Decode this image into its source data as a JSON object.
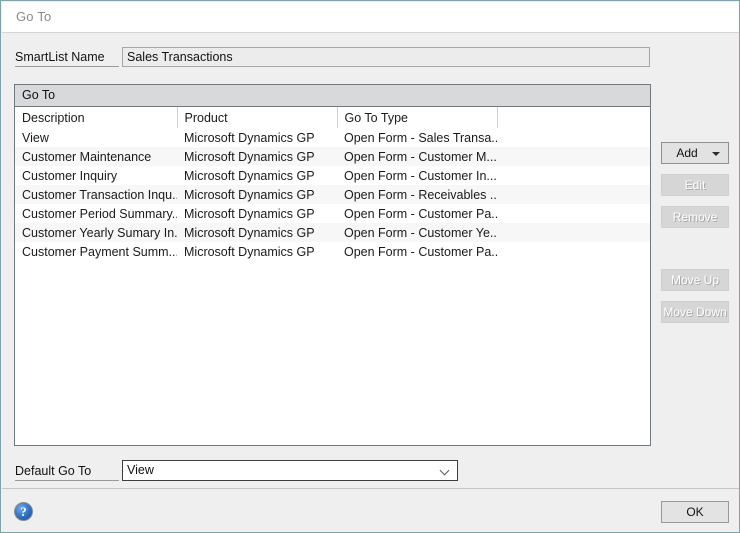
{
  "window": {
    "title": "Go To",
    "border_color": "#7fa3a8"
  },
  "smartlist": {
    "label": "SmartList Name",
    "value": "Sales Transactions"
  },
  "list": {
    "group_header": "Go To",
    "columns": [
      "Description",
      "Product",
      "Go To Type",
      ""
    ],
    "rows": [
      {
        "description": "View",
        "product": "Microsoft Dynamics GP",
        "goto_type": "Open Form - Sales Transa..."
      },
      {
        "description": "Customer Maintenance",
        "product": "Microsoft Dynamics GP",
        "goto_type": "Open Form - Customer M..."
      },
      {
        "description": "Customer Inquiry",
        "product": "Microsoft Dynamics GP",
        "goto_type": "Open Form - Customer In..."
      },
      {
        "description": "Customer Transaction Inqu...",
        "product": "Microsoft Dynamics GP",
        "goto_type": "Open Form - Receivables ..."
      },
      {
        "description": "Customer Period Summary...",
        "product": "Microsoft Dynamics GP",
        "goto_type": "Open Form - Customer Pa..."
      },
      {
        "description": "Customer Yearly Sumary In...",
        "product": "Microsoft Dynamics GP",
        "goto_type": "Open Form - Customer Ye..."
      },
      {
        "description": "Customer Payment Summ...",
        "product": "Microsoft Dynamics GP",
        "goto_type": "Open Form - Customer Pa..."
      }
    ]
  },
  "buttons": {
    "add": "Add",
    "edit": "Edit",
    "remove": "Remove",
    "move_up": "Move Up",
    "move_down": "Move Down",
    "ok": "OK"
  },
  "default_goto": {
    "label": "Default Go To",
    "value": "View"
  },
  "footer": {
    "help_glyph": "?"
  }
}
